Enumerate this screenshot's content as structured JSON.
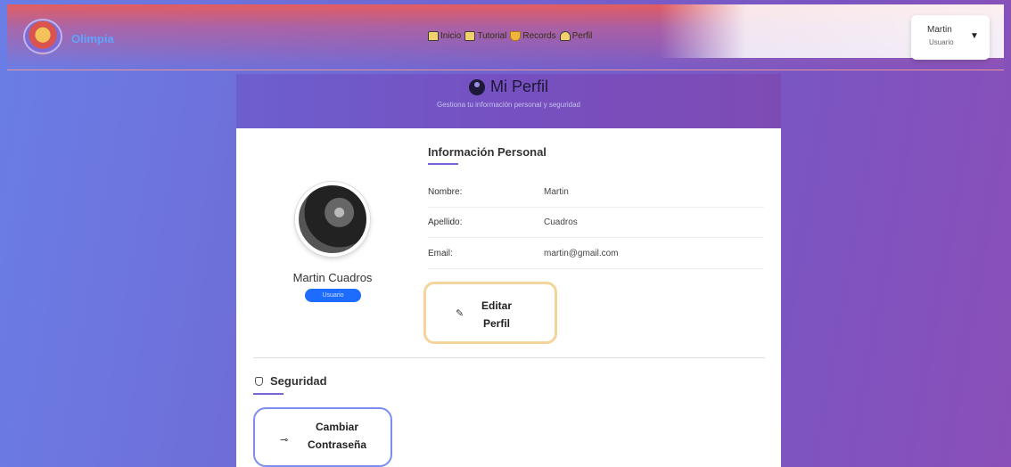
{
  "header": {
    "brand": "Olimpia",
    "nav": [
      {
        "label": "Inicio",
        "icon": "home-icon"
      },
      {
        "label": "Tutorial",
        "icon": "book-icon"
      },
      {
        "label": "Records",
        "icon": "trophy-icon"
      },
      {
        "label": "Perfil",
        "icon": "user-icon"
      }
    ],
    "user": {
      "name": "Martin",
      "role": "Usuario"
    }
  },
  "profile": {
    "title": "Mi Perfil",
    "subtitle": "Gestiona tu información personal y seguridad",
    "full_name": "Martin Cuadros",
    "role_badge": "Usuario",
    "personal_info": {
      "title": "Información Personal",
      "rows": [
        {
          "label": "Nombre:",
          "value": "Martin"
        },
        {
          "label": "Apellido:",
          "value": "Cuadros"
        },
        {
          "label": "Email:",
          "value": "martin@gmail.com"
        }
      ]
    },
    "edit_button": "Editar Perfil",
    "security": {
      "title": "Seguridad",
      "change_password_button": "Cambiar Contraseña"
    }
  },
  "colors": {
    "accent": "#7b65d6",
    "badge": "#1e6bff",
    "edit_border": "#f4d49a",
    "password_border": "#7b8df0"
  }
}
